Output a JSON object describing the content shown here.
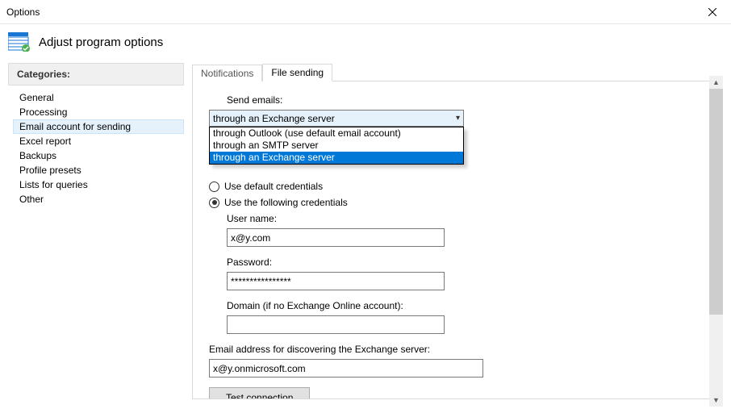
{
  "window": {
    "title": "Options"
  },
  "header": {
    "title": "Adjust program options"
  },
  "sidebar": {
    "heading": "Categories:",
    "items": [
      {
        "label": "General"
      },
      {
        "label": "Processing"
      },
      {
        "label": "Email account for sending"
      },
      {
        "label": "Excel report"
      },
      {
        "label": "Backups"
      },
      {
        "label": "Profile presets"
      },
      {
        "label": "Lists for queries"
      },
      {
        "label": "Other"
      }
    ],
    "selected_index": 2
  },
  "tabs": [
    {
      "label": "Notifications"
    },
    {
      "label": "File sending"
    }
  ],
  "active_tab": 1,
  "form": {
    "send_emails_label": "Send emails:",
    "send_emails_selected": "through an Exchange server",
    "send_emails_options": [
      "through Outlook (use default email account)",
      "through an SMTP server",
      "through an Exchange server"
    ],
    "dropdown_highlight_index": 2,
    "radio_default": "Use default credentials",
    "radio_following": "Use the following credentials",
    "radio_selected": "following",
    "username_label": "User name:",
    "username_value": "x@y.com",
    "password_label": "Password:",
    "password_value": "****************",
    "domain_label": "Domain (if no Exchange Online account):",
    "domain_value": "",
    "discovery_label": "Email address for discovering the Exchange server:",
    "discovery_value": "x@y.onmicrosoft.com",
    "test_button": "Test connection"
  }
}
